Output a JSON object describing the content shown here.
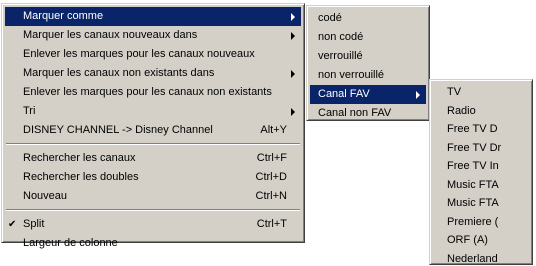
{
  "main_menu": {
    "items": [
      {
        "label": "Marquer comme",
        "shortcut": "",
        "submenu": true,
        "highlight": true
      },
      {
        "label": "Marquer les canaux nouveaux dans",
        "shortcut": "",
        "submenu": true
      },
      {
        "label": "Enlever les marques pour les canaux nouveaux",
        "shortcut": "",
        "submenu": false
      },
      {
        "label": "Marquer les canaux non existants dans",
        "shortcut": "",
        "submenu": true
      },
      {
        "label": "Enlever les marques pour les canaux non existants",
        "shortcut": "",
        "submenu": false
      },
      {
        "label": "Tri",
        "shortcut": "",
        "submenu": true
      },
      {
        "label": "DISNEY CHANNEL -> Disney Channel",
        "shortcut": "Alt+Y",
        "submenu": false
      },
      {
        "label": "Rechercher les canaux",
        "shortcut": "Ctrl+F",
        "submenu": false
      },
      {
        "label": "Rechercher les doubles",
        "shortcut": "Ctrl+D",
        "submenu": false
      },
      {
        "label": "Nouveau",
        "shortcut": "Ctrl+N",
        "submenu": false
      },
      {
        "label": "Split",
        "shortcut": "Ctrl+T",
        "submenu": false,
        "checked": true,
        "check_glyph": "✔"
      },
      {
        "label": "Largeur de colonne",
        "shortcut": "",
        "submenu": false
      }
    ]
  },
  "submenu_marquer": {
    "items": [
      {
        "label": "codé"
      },
      {
        "label": "non codé"
      },
      {
        "label": "verrouillé"
      },
      {
        "label": "non verrouillé"
      },
      {
        "label": "Canal FAV",
        "submenu": true,
        "highlight": true
      },
      {
        "label": "Canal non FAV"
      }
    ]
  },
  "submenu_fav": {
    "items": [
      {
        "label": "TV"
      },
      {
        "label": "Radio"
      },
      {
        "label": "Free TV D"
      },
      {
        "label": "Free TV Dr"
      },
      {
        "label": "Free TV In"
      },
      {
        "label": "Music FTA"
      },
      {
        "label": "Music FTA"
      },
      {
        "label": "Premiere ("
      },
      {
        "label": "ORF (A)"
      },
      {
        "label": "Nederland"
      }
    ]
  },
  "colors": {
    "menu_bg": "#d4d0c8",
    "highlight_bg": "#0a246a",
    "highlight_text": "#ffffff"
  }
}
